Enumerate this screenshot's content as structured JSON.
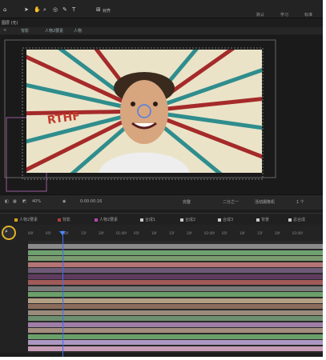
{
  "colors": {
    "accent": "#3b6df0",
    "highlight_circle": "#e0b22a"
  },
  "topbar": {
    "tools": [
      "select-tool",
      "hand-tool",
      "zoom-tool",
      "camera-tool",
      "pen-tool",
      "text-tool"
    ],
    "snap_label": "对齐",
    "workspaces": [
      "默认",
      "学习",
      "标准"
    ]
  },
  "viewer": {
    "comp_name": "图层 (无)",
    "breadcrumbs": [
      "背影",
      "人物2要素",
      "人物"
    ],
    "artwork_text": "RTHF"
  },
  "viewbar": {
    "zoom": "40%",
    "timecode": "0:00:00:16",
    "quality": "完整",
    "resolution": "二分之一",
    "camera": "活动摄像机",
    "views": "1 个"
  },
  "comp_tabs": [
    {
      "label": "人物2要素",
      "color": "#d0a21d"
    },
    {
      "label": "背影",
      "color": "#b43b3b"
    },
    {
      "label": "人物2要素",
      "color": "#b447a8"
    },
    {
      "label": "合成1",
      "color": "#c9c9c9"
    },
    {
      "label": "合成2",
      "color": "#c9c9c9"
    },
    {
      "label": "合成3",
      "color": "#c9c9c9"
    },
    {
      "label": "背景",
      "color": "#c9c9c9"
    },
    {
      "label": "总合成",
      "color": "#c9c9c9"
    }
  ],
  "timeline": {
    "timecode": "0:00:00:16",
    "ruler": [
      "00f",
      "05f",
      "10f",
      "15f",
      "20f",
      "01:00f",
      "05f",
      "10f",
      "15f",
      "20f",
      "02:00f",
      "05f",
      "10f",
      "15f",
      "20f",
      "03:00f"
    ],
    "layers": [
      {
        "label": "",
        "color": "#8b8b8b"
      },
      {
        "label": "",
        "color": "#6fa06f"
      },
      {
        "label": "",
        "color": "#7a9a6f"
      },
      {
        "label": "",
        "color": "#b47474"
      },
      {
        "label": "",
        "color": "#6e5a76"
      },
      {
        "label": "",
        "color": "#5f3b5f"
      },
      {
        "label": "",
        "color": "#a15a5a"
      },
      {
        "label": "",
        "color": "#7a7a7a"
      },
      {
        "label": "",
        "color": "#6ba06b"
      },
      {
        "label": "",
        "color": "#b29f84"
      },
      {
        "label": "",
        "color": "#8b6b5b"
      },
      {
        "label": "",
        "color": "#9a8b7b"
      },
      {
        "label": "",
        "color": "#6e8f6e"
      },
      {
        "label": "",
        "color": "#9e7ea7"
      },
      {
        "label": "",
        "color": "#a38d7f"
      },
      {
        "label": "",
        "color": "#6ba06b"
      },
      {
        "label": "",
        "color": "#ad97c2"
      },
      {
        "label": "",
        "color": "#c59bb6"
      }
    ]
  }
}
